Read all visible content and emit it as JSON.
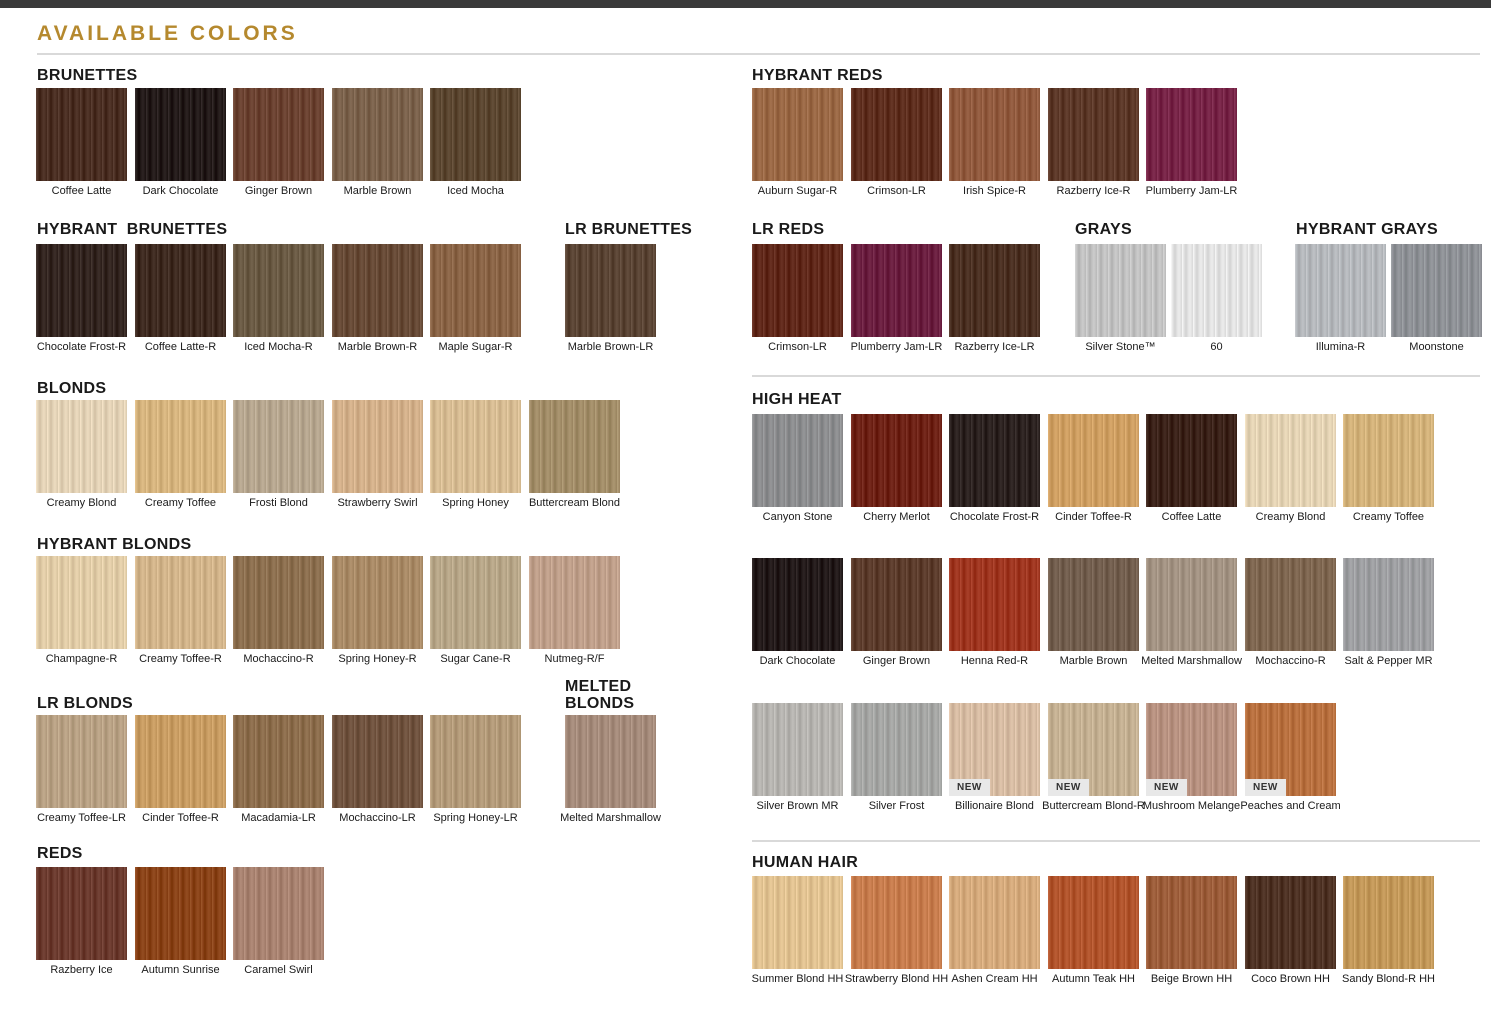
{
  "title": "AVAILABLE COLORS",
  "sections": {
    "brunettes": "BRUNETTES",
    "hybrant_brunettes": "HYBRANT  BRUNETTES",
    "lr_brunettes": "LR BRUNETTES",
    "blonds": "BLONDS",
    "hybrant_blonds": "HYBRANT BLONDS",
    "lr_blonds": "LR BLONDS",
    "melted_blonds": "MELTED BLONDS",
    "reds": "REDS",
    "hybrant_reds": "HYBRANT REDS",
    "lr_reds": "LR REDS",
    "grays": "GRAYS",
    "hybrant_grays": "HYBRANT GRAYS",
    "high_heat": "HIGH HEAT",
    "human_hair": "HUMAN HAIR"
  },
  "new_badge": "NEW",
  "swatches": {
    "brunettes": [
      {
        "label": "Coffee Latte",
        "color": "#4a2e22"
      },
      {
        "label": "Dark Chocolate",
        "color": "#231a19"
      },
      {
        "label": "Ginger Brown",
        "color": "#6b4231"
      },
      {
        "label": "Marble Brown",
        "color": "#7b624c"
      },
      {
        "label": "Iced Mocha",
        "color": "#5b4630"
      }
    ],
    "hybrant_brunettes": [
      {
        "label": "Chocolate Frost-R",
        "color": "#332520"
      },
      {
        "label": "Coffee Latte-R",
        "color": "#3e2a20"
      },
      {
        "label": "Iced Mocha-R",
        "color": "#6a5a44"
      },
      {
        "label": "Marble Brown-R",
        "color": "#674a36"
      },
      {
        "label": "Maple Sugar-R",
        "color": "#8a6446"
      }
    ],
    "lr_brunettes": [
      {
        "label": "Marble Brown-LR",
        "color": "#5a4434"
      }
    ],
    "blonds": [
      {
        "label": "Creamy Blond",
        "color": "#e3d2b6"
      },
      {
        "label": "Creamy Toffee",
        "color": "#d6b47e"
      },
      {
        "label": "Frosti Blond",
        "color": "#b6a68f"
      },
      {
        "label": "Strawberry Swirl",
        "color": "#d3b08a"
      },
      {
        "label": "Spring Honey",
        "color": "#d7bc93"
      },
      {
        "label": "Buttercream Blond",
        "color": "#a28d68"
      }
    ],
    "hybrant_blonds": [
      {
        "label": "Champagne-R",
        "color": "#e1cca7"
      },
      {
        "label": "Creamy Toffee-R",
        "color": "#d2b48a"
      },
      {
        "label": "Mochaccino-R",
        "color": "#8c6f4f"
      },
      {
        "label": "Spring Honey-R",
        "color": "#a98a66"
      },
      {
        "label": "Sugar Cane-R",
        "color": "#b7a688"
      },
      {
        "label": "Nutmeg-R/F",
        "color": "#bf9f8a"
      }
    ],
    "lr_blonds": [
      {
        "label": "Creamy Toffee-LR",
        "color": "#b8a184"
      },
      {
        "label": "Cinder Toffee-R",
        "color": "#c89c62"
      },
      {
        "label": "Macadamia-LR",
        "color": "#8c6d4c"
      },
      {
        "label": "Mochaccino-LR",
        "color": "#70533f"
      },
      {
        "label": "Spring Honey-LR",
        "color": "#b39a79"
      }
    ],
    "melted_blonds": [
      {
        "label": "Melted Marshmallow",
        "color": "#a58b7b"
      }
    ],
    "reds": [
      {
        "label": "Razberry Ice",
        "color": "#6b3a2e"
      },
      {
        "label": "Autumn Sunrise",
        "color": "#8a4318"
      },
      {
        "label": "Caramel Swirl",
        "color": "#a88270"
      }
    ],
    "hybrant_reds": [
      {
        "label": "Auburn Sugar-R",
        "color": "#9a6845"
      },
      {
        "label": "Crimson-LR",
        "color": "#5e2e1e"
      },
      {
        "label": "Irish Spice-R",
        "color": "#915a3e"
      },
      {
        "label": "Razberry Ice-R",
        "color": "#5c3828"
      },
      {
        "label": "Plumberry Jam-LR",
        "color": "#772447"
      }
    ],
    "lr_reds": [
      {
        "label": "Crimson-LR",
        "color": "#60281a"
      },
      {
        "label": "Plumberry Jam-LR",
        "color": "#6b1f40"
      },
      {
        "label": "Razberry Ice-LR",
        "color": "#4b3022"
      }
    ],
    "grays": [
      {
        "label": "Silver Stone™",
        "color": "#c2c2c2"
      },
      {
        "label": "60",
        "color": "#e3e3e3"
      }
    ],
    "hybrant_grays": [
      {
        "label": "Illumina-R",
        "color": "#b5b8bc"
      },
      {
        "label": "Moonstone",
        "color": "#8e9196"
      }
    ],
    "high_heat_1": [
      {
        "label": "Canyon Stone",
        "color": "#8c8d8f"
      },
      {
        "label": "Cherry Merlot",
        "color": "#6e2216"
      },
      {
        "label": "Chocolate Frost-R",
        "color": "#2c2220"
      },
      {
        "label": "Cinder Toffee-R",
        "color": "#cf9f62"
      },
      {
        "label": "Coffee Latte",
        "color": "#3b2219"
      },
      {
        "label": "Creamy Blond",
        "color": "#e4d3b4"
      },
      {
        "label": "Creamy Toffee",
        "color": "#d3b27a"
      }
    ],
    "high_heat_2": [
      {
        "label": "Dark Chocolate",
        "color": "#231a1a"
      },
      {
        "label": "Ginger Brown",
        "color": "#5c3c2c"
      },
      {
        "label": "Henna Red-R",
        "color": "#9f3620"
      },
      {
        "label": "Marble Brown",
        "color": "#725e4e"
      },
      {
        "label": "Melted Marshmallow",
        "color": "#a39383"
      },
      {
        "label": "Mochaccino-R",
        "color": "#7e6650"
      },
      {
        "label": "Salt & Pepper MR",
        "color": "#9e9fa2"
      }
    ],
    "high_heat_3": [
      {
        "label": "Silver Brown MR",
        "color": "#b6b4b0",
        "isNew": false
      },
      {
        "label": "Silver Frost",
        "color": "#a5a6a4",
        "isNew": false
      },
      {
        "label": "Billionaire Blond",
        "color": "#d7bca3",
        "isNew": true
      },
      {
        "label": "Buttercream Blond-R",
        "color": "#c4b092",
        "isNew": true
      },
      {
        "label": "Mushroom Melange",
        "color": "#b79180",
        "isNew": true
      },
      {
        "label": "Peaches and Cream",
        "color": "#b8703f",
        "isNew": true
      }
    ],
    "human_hair": [
      {
        "label": "Summer Blond HH",
        "color": "#e1c291"
      },
      {
        "label": "Strawberry Blond HH",
        "color": "#c77c4d"
      },
      {
        "label": "Ashen Cream HH",
        "color": "#d5aa7c"
      },
      {
        "label": "Autumn Teak HH",
        "color": "#b1542c"
      },
      {
        "label": "Beige Brown HH",
        "color": "#9c5d3a"
      },
      {
        "label": "Coco Brown HH",
        "color": "#4e3224"
      },
      {
        "label": "Sandy Blond-R HH",
        "color": "#c39859"
      }
    ]
  }
}
